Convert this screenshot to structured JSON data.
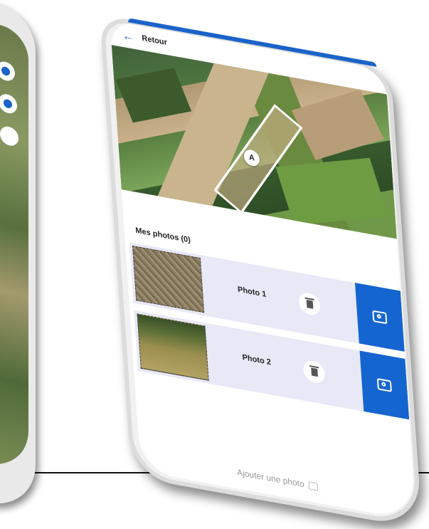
{
  "header": {
    "back_label": "Retour",
    "back_icon": "arrow-left-icon"
  },
  "map": {
    "parcel_marker": "A"
  },
  "photos": {
    "title": "Mes photos (0)",
    "items": [
      {
        "label": "Photo 1"
      },
      {
        "label": "Photo 2"
      }
    ]
  },
  "footer": {
    "add_label": "Ajouter une photo"
  },
  "colors": {
    "accent": "#1565d0",
    "row_bg": "#e8e8f6"
  }
}
